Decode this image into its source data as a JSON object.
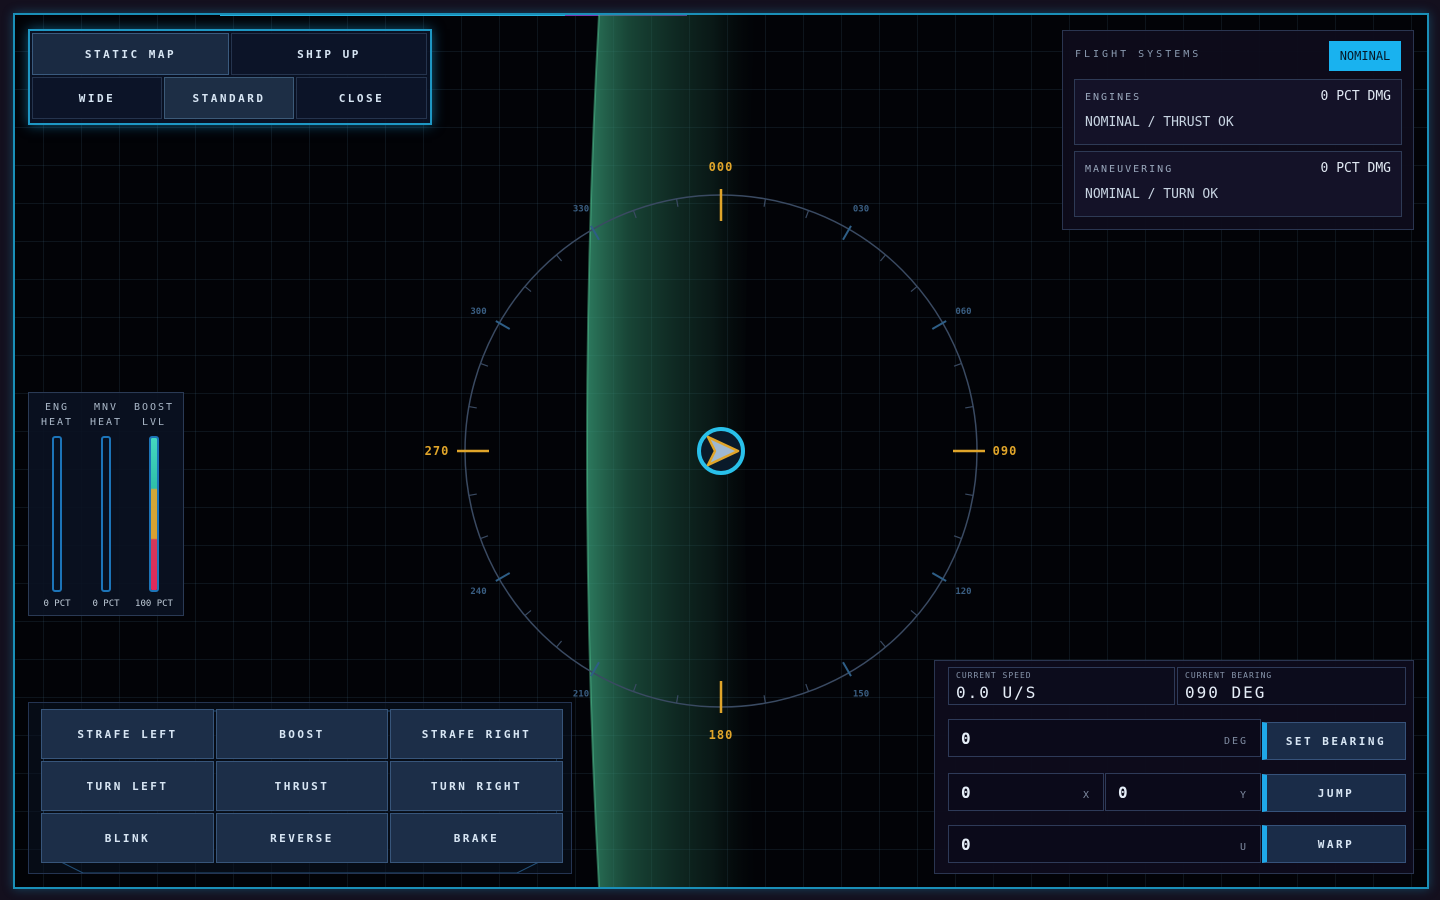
{
  "view_controls": {
    "static_map": "STATIC MAP",
    "ship_up": "SHIP UP",
    "wide": "WIDE",
    "standard": "STANDARD",
    "close": "CLOSE",
    "active": "standard"
  },
  "compass": {
    "cardinal": [
      "000",
      "090",
      "180",
      "270"
    ],
    "minor": [
      "030",
      "060",
      "120",
      "150",
      "210",
      "240",
      "300",
      "330"
    ],
    "ship_heading_deg": 90,
    "ship_icon": "ship-arrow-icon"
  },
  "flight_systems": {
    "title": "FLIGHT SYSTEMS",
    "status": "NOMINAL",
    "engines": {
      "name": "ENGINES",
      "damage": "0 PCT DMG",
      "status": "NOMINAL / THRUST OK"
    },
    "maneuvering": {
      "name": "MANEUVERING",
      "damage": "0 PCT DMG",
      "status": "NOMINAL / TURN OK"
    }
  },
  "gauges": [
    {
      "label1": "ENG",
      "label2": "HEAT",
      "value": "0 PCT",
      "level": 0
    },
    {
      "label1": "MNV",
      "label2": "HEAT",
      "value": "0 PCT",
      "level": 0
    },
    {
      "label1": "BOOST",
      "label2": "LVL",
      "value": "100 PCT",
      "level": 1.0
    }
  ],
  "movement": {
    "strafe_left": "STRAFE LEFT",
    "boost": "BOOST",
    "strafe_right": "STRAFE RIGHT",
    "turn_left": "TURN LEFT",
    "thrust": "THRUST",
    "turn_right": "TURN RIGHT",
    "blink": "BLINK",
    "reverse": "REVERSE",
    "brake": "BRAKE"
  },
  "nav": {
    "speed_label": "CURRENT SPEED",
    "speed_value": "0.0 U/S",
    "bearing_label": "CURRENT BEARING",
    "bearing_value": "090 DEG",
    "bearing_input": "0",
    "bearing_unit": "DEG",
    "set_bearing": "SET BEARING",
    "jump_x": "0",
    "jump_x_unit": "X",
    "jump_y": "0",
    "jump_y_unit": "Y",
    "jump": "JUMP",
    "warp_input": "0",
    "warp_unit": "U",
    "warp": "WARP"
  },
  "colors": {
    "accent": "#1fb2ec",
    "heading": "#e0a52a",
    "planet_atmosphere": "#2f8d6a",
    "frame": "#1a8fb8"
  }
}
